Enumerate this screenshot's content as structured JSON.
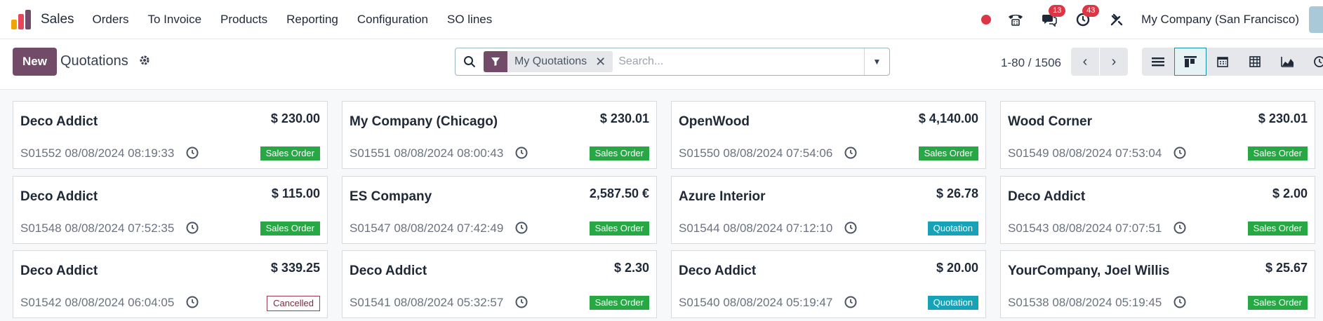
{
  "app": {
    "name": "Sales",
    "colors": {
      "brand": "#714B67",
      "accent": "#017e84",
      "danger": "#dc3545",
      "success": "#28a745",
      "info": "#17a2b8"
    }
  },
  "navbar": {
    "menu": [
      "Orders",
      "To Invoice",
      "Products",
      "Reporting",
      "Configuration",
      "SO lines"
    ],
    "messages_count": "13",
    "activities_count": "43",
    "company": "My Company (San Francisco)"
  },
  "control": {
    "new_label": "New",
    "title": "Quotations",
    "facet_label": "My Quotations",
    "search_placeholder": "Search...",
    "pager": "1-80 / 1506"
  },
  "cards": [
    {
      "name": "Deco Addict",
      "amount": "$ 230.00",
      "ref": "S01552 08/08/2024 08:19:33",
      "status": "Sales Order",
      "status_type": "sale"
    },
    {
      "name": "My Company (Chicago)",
      "amount": "$ 230.01",
      "ref": "S01551 08/08/2024 08:00:43",
      "status": "Sales Order",
      "status_type": "sale"
    },
    {
      "name": "OpenWood",
      "amount": "$ 4,140.00",
      "ref": "S01550 08/08/2024 07:54:06",
      "status": "Sales Order",
      "status_type": "sale"
    },
    {
      "name": "Wood Corner",
      "amount": "$ 230.01",
      "ref": "S01549 08/08/2024 07:53:04",
      "status": "Sales Order",
      "status_type": "sale"
    },
    {
      "name": "Deco Addict",
      "amount": "$ 115.00",
      "ref": "S01548 08/08/2024 07:52:35",
      "status": "Sales Order",
      "status_type": "sale"
    },
    {
      "name": "ES Company",
      "amount": "2,587.50 €",
      "ref": "S01547 08/08/2024 07:42:49",
      "status": "Sales Order",
      "status_type": "sale"
    },
    {
      "name": "Azure Interior",
      "amount": "$ 26.78",
      "ref": "S01544 08/08/2024 07:12:10",
      "status": "Quotation",
      "status_type": "quote"
    },
    {
      "name": "Deco Addict",
      "amount": "$ 2.00",
      "ref": "S01543 08/08/2024 07:07:51",
      "status": "Sales Order",
      "status_type": "sale"
    },
    {
      "name": "Deco Addict",
      "amount": "$ 339.25",
      "ref": "S01542 08/08/2024 06:04:05",
      "status": "Cancelled",
      "status_type": "cancel"
    },
    {
      "name": "Deco Addict",
      "amount": "$ 2.30",
      "ref": "S01541 08/08/2024 05:32:57",
      "status": "Sales Order",
      "status_type": "sale"
    },
    {
      "name": "Deco Addict",
      "amount": "$ 20.00",
      "ref": "S01540 08/08/2024 05:19:47",
      "status": "Quotation",
      "status_type": "quote"
    },
    {
      "name": "YourCompany, Joel Willis",
      "amount": "$ 25.67",
      "ref": "S01538 08/08/2024 05:19:45",
      "status": "Sales Order",
      "status_type": "sale"
    }
  ]
}
